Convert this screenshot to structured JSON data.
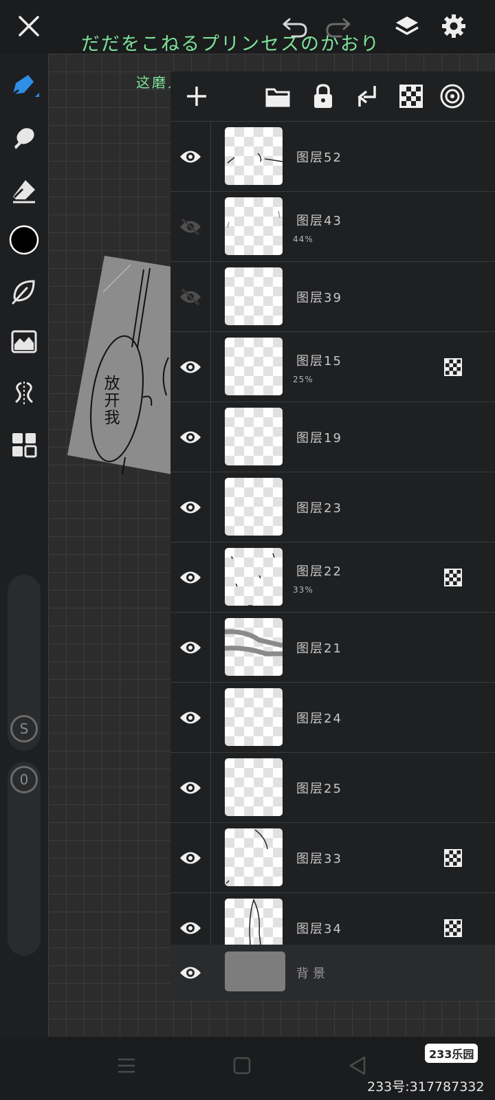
{
  "watermark": {
    "line1": "だだをこねるプリンセスのかおり",
    "line2": "这磨人的小公主身上的香气"
  },
  "canvas_text": "放开我",
  "layers": [
    {
      "name": "图层52",
      "opacity": "",
      "visible": true,
      "clipping": false
    },
    {
      "name": "图层43",
      "opacity": "44%",
      "visible": false,
      "clipping": false
    },
    {
      "name": "图层39",
      "opacity": "",
      "visible": false,
      "clipping": false
    },
    {
      "name": "图层15",
      "opacity": "25%",
      "visible": true,
      "clipping": true
    },
    {
      "name": "图层19",
      "opacity": "",
      "visible": true,
      "clipping": false
    },
    {
      "name": "图层23",
      "opacity": "",
      "visible": true,
      "clipping": false
    },
    {
      "name": "图层22",
      "opacity": "33%",
      "visible": true,
      "clipping": true
    },
    {
      "name": "图层21",
      "opacity": "",
      "visible": true,
      "clipping": false
    },
    {
      "name": "图层24",
      "opacity": "",
      "visible": true,
      "clipping": false
    },
    {
      "name": "图层25",
      "opacity": "",
      "visible": true,
      "clipping": false
    },
    {
      "name": "图层33",
      "opacity": "",
      "visible": true,
      "clipping": true
    },
    {
      "name": "图层34",
      "opacity": "",
      "visible": true,
      "clipping": true
    }
  ],
  "background_layer": {
    "name": "背景",
    "visible": true
  },
  "sliders": {
    "size_value": "S",
    "opacity_value": "0"
  },
  "colors": {
    "current_color": "#000000",
    "accent": "#2f8ee6",
    "watermark": "#7de39a"
  },
  "branding": {
    "logo": "233乐园",
    "user_id": "233号:317787332"
  },
  "icons": [
    "close-icon",
    "undo-icon",
    "redo-icon",
    "layers-icon",
    "settings-icon",
    "pen-icon",
    "smudge-icon",
    "eraser-icon",
    "leaf-icon",
    "image-icon",
    "symmetry-icon",
    "grid-icon",
    "add-icon",
    "folder-icon",
    "lock-icon",
    "merge-icon",
    "checker-icon",
    "target-icon",
    "eye-icon",
    "eye-off-icon",
    "menu-icon",
    "home-icon",
    "back-icon"
  ]
}
